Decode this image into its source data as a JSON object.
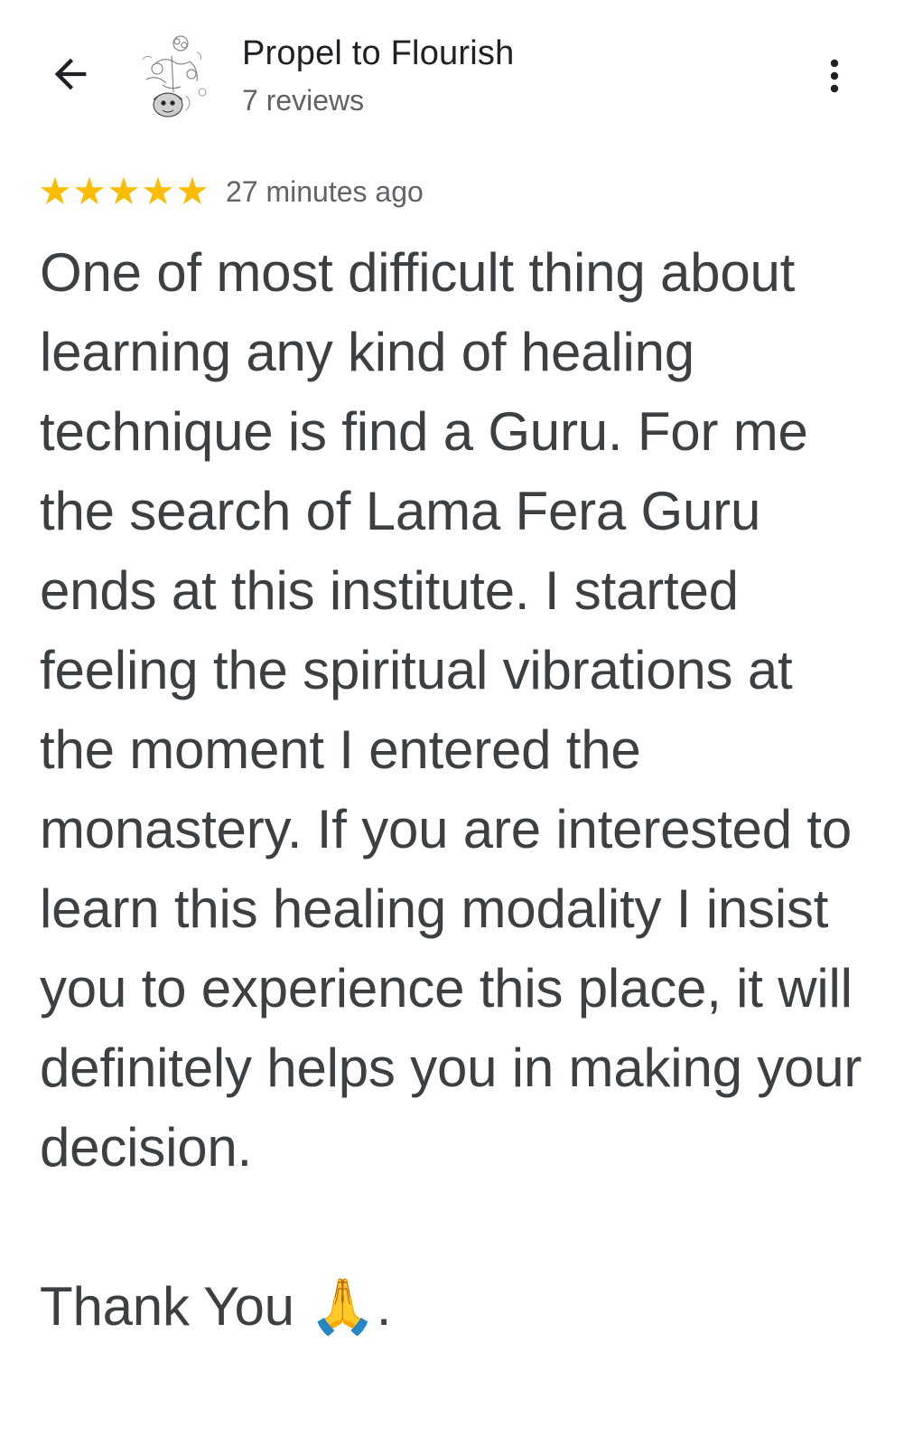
{
  "header": {
    "place_name": "Propel to Flourish",
    "review_count": "7 reviews",
    "back_icon": "arrow-back-icon",
    "more_icon": "more-vert-icon"
  },
  "review": {
    "rating": 5,
    "rating_max": 5,
    "star_color": "#fbbc04",
    "time": "27 minutes ago",
    "text": "One of most difficult thing about learning any kind of healing technique is find a Guru. For me the search of Lama Fera Guru ends at this institute. I started feeling the spiritual vibrations at the moment I entered the monastery. If you are interested to learn this healing modality I insist you to experience this place, it will definitely helps you in making your decision.\n\nThank You 🙏."
  }
}
